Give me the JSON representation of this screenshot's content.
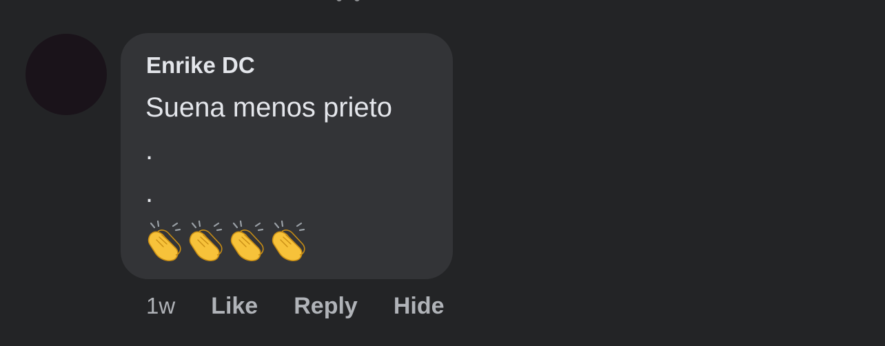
{
  "comment": {
    "author": "Enrike DC",
    "text_lines": [
      "Suena menos prieto",
      ".",
      "."
    ],
    "emoji_icons": [
      "clapping-hands-icon",
      "clapping-hands-icon",
      "clapping-hands-icon",
      "clapping-hands-icon"
    ],
    "timestamp": "1w",
    "actions": {
      "like": "Like",
      "reply": "Reply",
      "hide": "Hide"
    }
  },
  "colors": {
    "background": "#232426",
    "bubble": "#333437",
    "text_primary": "#e4e6eb",
    "text_secondary": "#b0b3b8",
    "avatar": "#1a131a",
    "emoji_yellow": "#f7c23a"
  }
}
